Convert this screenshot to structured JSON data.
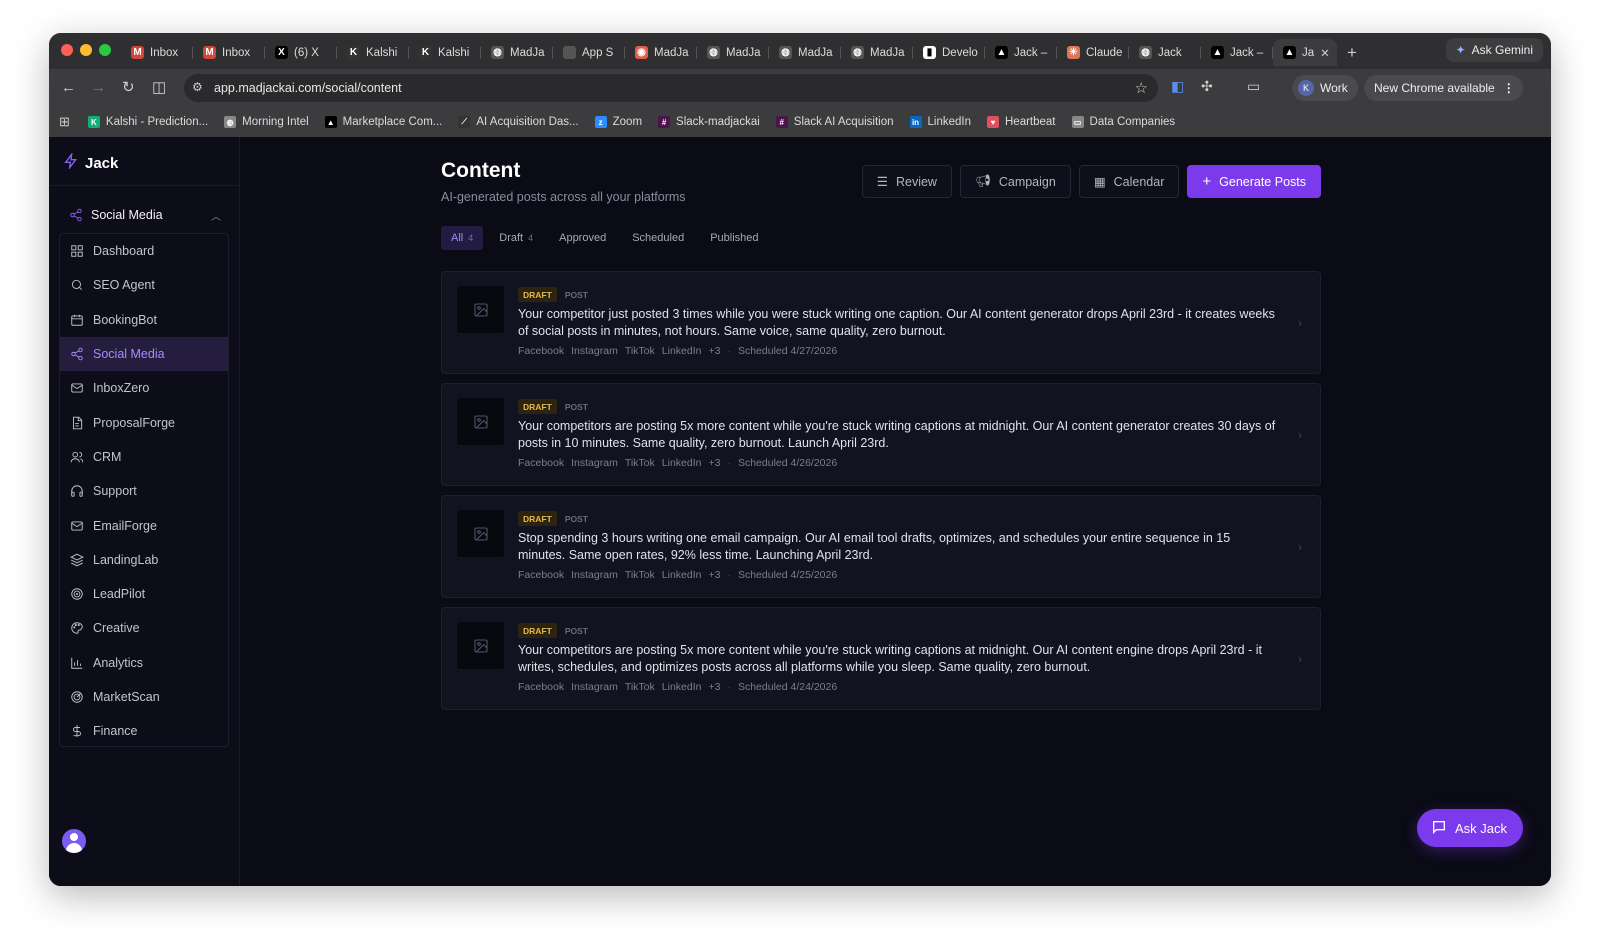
{
  "browser": {
    "tabs": [
      {
        "label": "Inbox",
        "icon": "gmail-icon",
        "color": "#d44638"
      },
      {
        "label": "Inbox",
        "icon": "gmail-icon",
        "color": "#d44638"
      },
      {
        "label": "(6) X",
        "icon": "x-icon",
        "color": "#000000"
      },
      {
        "label": "Kalshi",
        "icon": "kalshi-icon",
        "color": "#333333"
      },
      {
        "label": "Kalshi",
        "icon": "kalshi-icon",
        "color": "#333333"
      },
      {
        "label": "MadJa",
        "icon": "globe-icon",
        "color": "#555555"
      },
      {
        "label": "App S",
        "icon": "apple-icon",
        "color": "#555555"
      },
      {
        "label": "MadJa",
        "icon": "madja-icon",
        "color": "#e25d4b"
      },
      {
        "label": "MadJa",
        "icon": "globe-icon",
        "color": "#555555"
      },
      {
        "label": "MadJa",
        "icon": "globe-icon",
        "color": "#555555"
      },
      {
        "label": "MadJa",
        "icon": "globe-icon",
        "color": "#555555"
      },
      {
        "label": "Develo",
        "icon": "developer-icon",
        "color": "#ffffff"
      },
      {
        "label": "Jack –",
        "icon": "vercel-icon",
        "color": "#000000"
      },
      {
        "label": "Claude",
        "icon": "claude-icon",
        "color": "#d97757"
      },
      {
        "label": "Jack",
        "icon": "globe-icon",
        "color": "#555555"
      },
      {
        "label": "Jack –",
        "icon": "vercel-icon",
        "color": "#000000"
      },
      {
        "label": "Ja",
        "icon": "vercel-icon",
        "color": "#000000"
      }
    ],
    "new_tab": "+",
    "ask_gemini": "Ask Gemini",
    "url": "app.madjackai.com/social/content",
    "profile": "Work",
    "profile_initial": "K",
    "update_label": "New Chrome available",
    "bookmarks": [
      {
        "label": "Kalshi - Prediction...",
        "icon": "kalshi-icon",
        "color": "#0fb07a"
      },
      {
        "label": "Morning Intel",
        "icon": "globe-icon",
        "color": "#888888"
      },
      {
        "label": "Marketplace Com...",
        "icon": "vercel-icon",
        "color": "#000000"
      },
      {
        "label": "AI Acquisition Das...",
        "icon": "ai-icon",
        "color": "#333333"
      },
      {
        "label": "Zoom",
        "icon": "zoom-icon",
        "color": "#2d8cff"
      },
      {
        "label": "Slack-madjackai",
        "icon": "slack-icon",
        "color": "#4a154b"
      },
      {
        "label": "Slack AI Acquisition",
        "icon": "slack-icon",
        "color": "#4a154b"
      },
      {
        "label": "LinkedIn",
        "icon": "linkedin-icon",
        "color": "#0a66c2"
      },
      {
        "label": "Heartbeat",
        "icon": "heartbeat-icon",
        "color": "#e0505e"
      },
      {
        "label": "Data Companies",
        "icon": "folder-icon",
        "color": "#888888"
      }
    ]
  },
  "sidebar": {
    "brand": "Jack",
    "section": "Social Media",
    "items": [
      {
        "label": "Dashboard",
        "icon": "dashboard-icon",
        "active": false
      },
      {
        "label": "SEO Agent",
        "icon": "search-icon",
        "active": false
      },
      {
        "label": "BookingBot",
        "icon": "calendar-icon",
        "active": false
      },
      {
        "label": "Social Media",
        "icon": "share-icon",
        "active": true
      },
      {
        "label": "InboxZero",
        "icon": "mail-icon",
        "active": false
      },
      {
        "label": "ProposalForge",
        "icon": "document-icon",
        "active": false
      },
      {
        "label": "CRM",
        "icon": "users-icon",
        "active": false
      },
      {
        "label": "Support",
        "icon": "headphones-icon",
        "active": false
      },
      {
        "label": "EmailForge",
        "icon": "mail-icon",
        "active": false
      },
      {
        "label": "LandingLab",
        "icon": "layers-icon",
        "active": false
      },
      {
        "label": "LeadPilot",
        "icon": "target-icon",
        "active": false
      },
      {
        "label": "Creative",
        "icon": "palette-icon",
        "active": false
      },
      {
        "label": "Analytics",
        "icon": "chart-icon",
        "active": false
      },
      {
        "label": "MarketScan",
        "icon": "radar-icon",
        "active": false
      },
      {
        "label": "Finance",
        "icon": "dollar-icon",
        "active": false
      }
    ]
  },
  "main": {
    "title": "Content",
    "subtitle": "AI-generated posts across all your platforms",
    "actions": {
      "review": "Review",
      "campaign": "Campaign",
      "calendar": "Calendar",
      "generate": "Generate Posts"
    },
    "filters": [
      {
        "label": "All",
        "count": "4",
        "active": true
      },
      {
        "label": "Draft",
        "count": "4",
        "active": false
      },
      {
        "label": "Approved",
        "count": "",
        "active": false
      },
      {
        "label": "Scheduled",
        "count": "",
        "active": false
      },
      {
        "label": "Published",
        "count": "",
        "active": false
      }
    ],
    "posts": [
      {
        "status": "DRAFT",
        "type": "POST",
        "text": "Your competitor just posted 3 times while you were stuck writing one caption. Our AI content generator drops April 23rd - it creates weeks of social posts in minutes, not hours. Same voice, same quality, zero burnout.",
        "platforms": [
          "Facebook",
          "Instagram",
          "TikTok",
          "LinkedIn"
        ],
        "more": "+3",
        "scheduled": "Scheduled 4/27/2026"
      },
      {
        "status": "DRAFT",
        "type": "POST",
        "text": "Your competitors are posting 5x more content while you're stuck writing captions at midnight. Our AI content generator creates 30 days of posts in 10 minutes. Same quality, zero burnout. Launch April 23rd.",
        "platforms": [
          "Facebook",
          "Instagram",
          "TikTok",
          "LinkedIn"
        ],
        "more": "+3",
        "scheduled": "Scheduled 4/26/2026"
      },
      {
        "status": "DRAFT",
        "type": "POST",
        "text": "Stop spending 3 hours writing one email campaign. Our AI email tool drafts, optimizes, and schedules your entire sequence in 15 minutes. Same open rates, 92% less time. Launching April 23rd.",
        "platforms": [
          "Facebook",
          "Instagram",
          "TikTok",
          "LinkedIn"
        ],
        "more": "+3",
        "scheduled": "Scheduled 4/25/2026"
      },
      {
        "status": "DRAFT",
        "type": "POST",
        "text": "Your competitors are posting 5x more content while you're stuck writing captions at midnight. Our AI content engine drops April 23rd - it writes, schedules, and optimizes posts across all platforms while you sleep. Same quality, zero burnout.",
        "platforms": [
          "Facebook",
          "Instagram",
          "TikTok",
          "LinkedIn"
        ],
        "more": "+3",
        "scheduled": "Scheduled 4/24/2026"
      }
    ]
  },
  "ask_jack": "Ask Jack",
  "colors": {
    "accent": "#7c3aed",
    "active_text": "#a78bfa",
    "draft_badge": "#e6b84a",
    "background": "#0b0b16"
  }
}
